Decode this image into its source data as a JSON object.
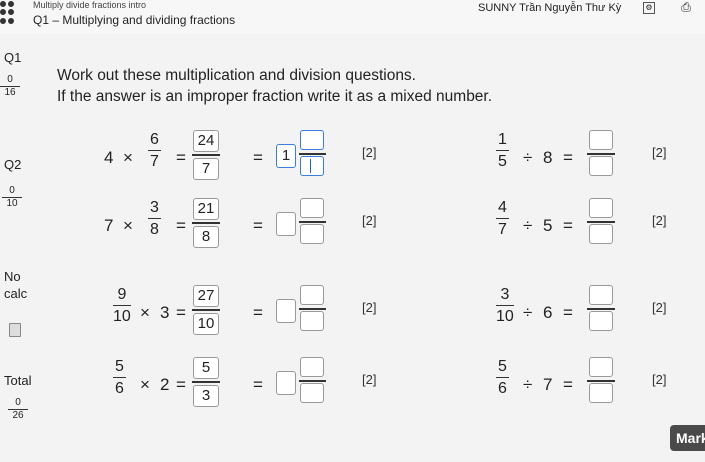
{
  "header": {
    "breadcrumb": "Multiply divide fractions intro",
    "title": "Q1 – Multiplying and dividing fractions",
    "student": "SUNNY Trần Nguyễn Thư Kỳ"
  },
  "sidebar": {
    "q1_label": "Q1",
    "q1_score": {
      "num": "0",
      "den": "16"
    },
    "q2_label": "Q2",
    "q2_score": {
      "num": "0",
      "den": "10"
    },
    "calc_line1": "No",
    "calc_line2": "calc",
    "total_label": "Total",
    "total_score": {
      "num": "0",
      "den": "26"
    }
  },
  "instructions": {
    "line1": "Work out these multiplication and division questions.",
    "line2": "If the answer is an improper fraction write it as a mixed number."
  },
  "left_questions": [
    {
      "whole": "4",
      "op": "×",
      "num": "6",
      "den": "7",
      "ans_num": "24",
      "ans_den": "7",
      "mixed_whole": "1",
      "marks": "[2]"
    },
    {
      "whole": "7",
      "op": "×",
      "num": "3",
      "den": "8",
      "ans_num": "21",
      "ans_den": "8",
      "mixed_whole": "",
      "marks": "[2]"
    },
    {
      "whole": "3",
      "op": "×",
      "num": "9",
      "den": "10",
      "ans_num": "27",
      "ans_den": "10",
      "mixed_whole": "",
      "marks": "[2]"
    },
    {
      "whole": "2",
      "op": "×",
      "num": "5",
      "den": "6",
      "ans_num": "5",
      "ans_den": "3",
      "mixed_whole": "",
      "marks": "[2]"
    }
  ],
  "right_questions": [
    {
      "num": "1",
      "den": "5",
      "op": "÷",
      "whole": "8",
      "marks": "[2]"
    },
    {
      "num": "4",
      "den": "7",
      "op": "÷",
      "whole": "5",
      "marks": "[2]"
    },
    {
      "num": "3",
      "den": "10",
      "op": "÷",
      "whole": "6",
      "marks": "[2]"
    },
    {
      "num": "5",
      "den": "6",
      "op": "÷",
      "whole": "7",
      "marks": "[2]"
    }
  ],
  "symbols": {
    "equals": "="
  },
  "mark_button": "Mark"
}
